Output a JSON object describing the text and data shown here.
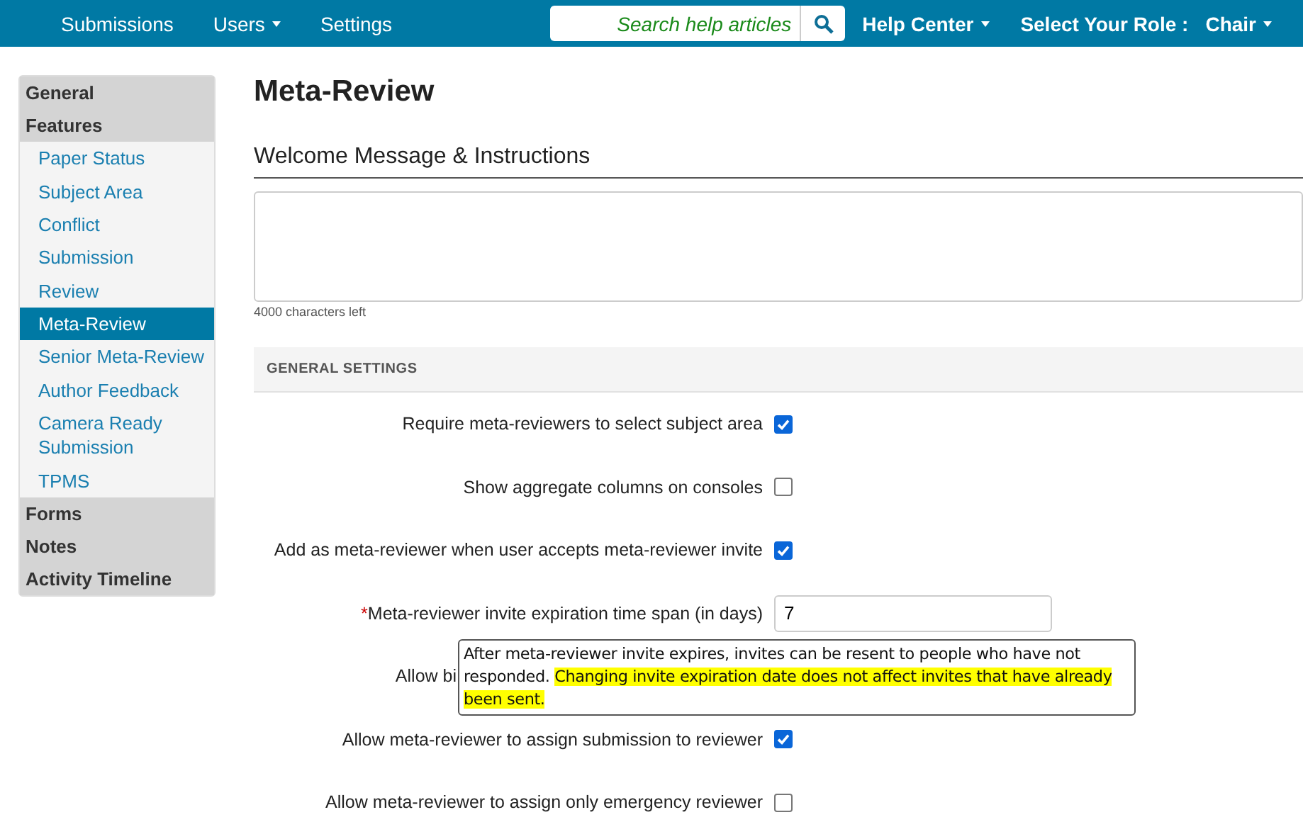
{
  "navbar": {
    "left_items": [
      {
        "label": "Submissions",
        "dropdown": false
      },
      {
        "label": "Users",
        "dropdown": true
      },
      {
        "label": "Settings",
        "dropdown": false
      }
    ],
    "search": {
      "placeholder": "Search help articles"
    },
    "right_items": [
      {
        "label": "Help Center",
        "dropdown": true
      },
      {
        "label": "Select Your Role :",
        "dropdown": false
      },
      {
        "label": "Chair",
        "dropdown": true
      }
    ]
  },
  "sidebar": {
    "items": [
      {
        "label": "General",
        "kind": "section"
      },
      {
        "label": "Features",
        "kind": "section"
      },
      {
        "label": "Paper Status",
        "kind": "link",
        "selected": false
      },
      {
        "label": "Subject Area",
        "kind": "link",
        "selected": false
      },
      {
        "label": "Conflict",
        "kind": "link",
        "selected": false
      },
      {
        "label": "Submission",
        "kind": "link",
        "selected": false
      },
      {
        "label": "Review",
        "kind": "link",
        "selected": false
      },
      {
        "label": "Meta-Review",
        "kind": "link",
        "selected": true
      },
      {
        "label": "Senior Meta-Review",
        "kind": "link",
        "selected": false
      },
      {
        "label": "Author Feedback",
        "kind": "link",
        "selected": false
      },
      {
        "label": "Camera Ready Submission",
        "kind": "link",
        "selected": false
      },
      {
        "label": "TPMS",
        "kind": "link",
        "selected": false
      },
      {
        "label": "Forms",
        "kind": "section"
      },
      {
        "label": "Notes",
        "kind": "section"
      },
      {
        "label": "Activity Timeline",
        "kind": "section"
      }
    ]
  },
  "page_title": "Meta-Review",
  "welcome": {
    "heading": "Welcome Message & Instructions",
    "counter": "4000 characters left"
  },
  "general_settings": {
    "heading": "GENERAL SETTINGS",
    "rows": [
      {
        "kind": "checkbox",
        "label": "Require meta-reviewers to select subject area",
        "checked": true
      },
      {
        "kind": "checkbox",
        "label": "Show aggregate columns on consoles",
        "checked": false
      },
      {
        "kind": "checkbox",
        "label": "Add as meta-reviewer when user accepts meta-reviewer invite",
        "checked": true
      },
      {
        "kind": "number",
        "required_mark": "*",
        "label": "Meta-reviewer invite expiration time span (in days)",
        "value": "7"
      },
      {
        "kind": "covered",
        "label": "Allow bi"
      },
      {
        "kind": "checkbox",
        "label": "Allow meta-reviewer to assign submission to reviewer",
        "checked": true
      },
      {
        "kind": "checkbox",
        "label": "Allow meta-reviewer to assign only emergency reviewer",
        "checked": false
      }
    ]
  },
  "tooltip": {
    "text": "After meta-reviewer invite expires, invites can be resent to people who have not responded.",
    "highlight": "Changing invite expiration date does not affect invites that have already been sent."
  }
}
